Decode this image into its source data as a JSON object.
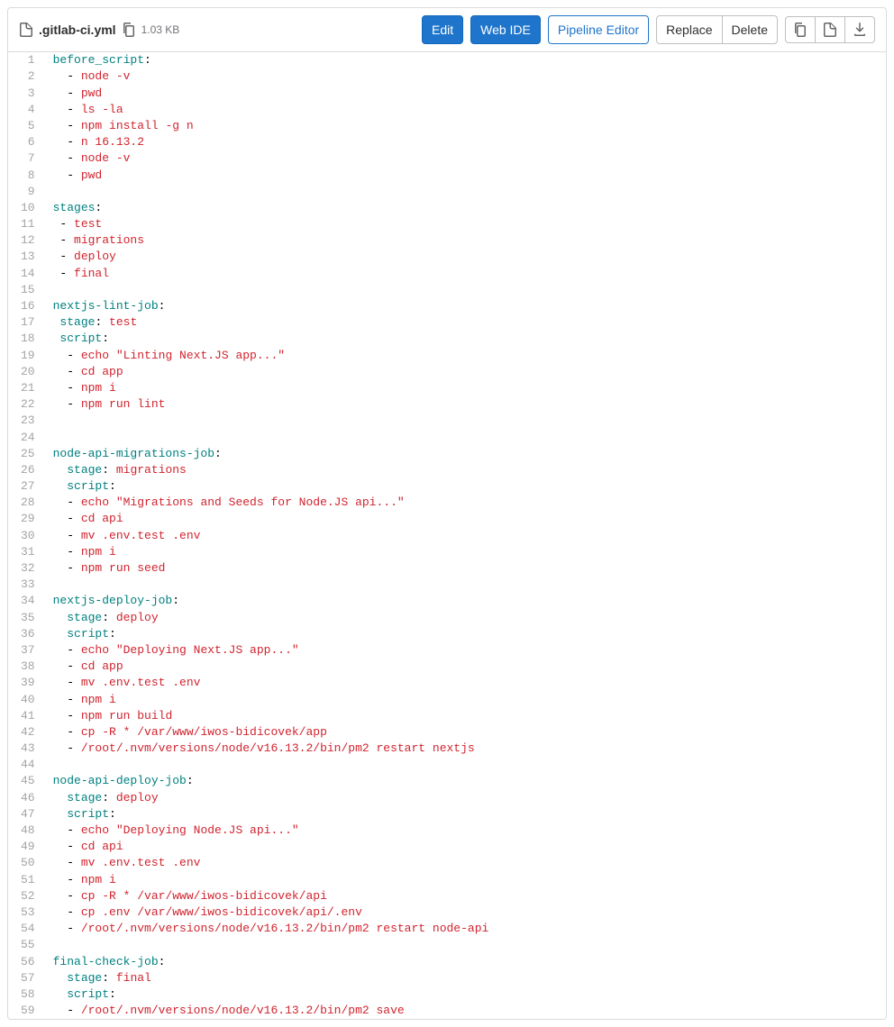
{
  "header": {
    "filename": ".gitlab-ci.yml",
    "filesize": "1.03 KB",
    "buttons": {
      "edit": "Edit",
      "web_ide": "Web IDE",
      "pipeline_editor": "Pipeline Editor",
      "replace": "Replace",
      "delete": "Delete"
    }
  },
  "code": {
    "lines": [
      {
        "n": 1,
        "t": "key",
        "indent": "",
        "key": "before_script",
        "colon": true
      },
      {
        "n": 2,
        "t": "item",
        "indent": "  ",
        "text": "node -v"
      },
      {
        "n": 3,
        "t": "item",
        "indent": "  ",
        "text": "pwd"
      },
      {
        "n": 4,
        "t": "item",
        "indent": "  ",
        "text": "ls -la"
      },
      {
        "n": 5,
        "t": "item",
        "indent": "  ",
        "text": "npm install -g n"
      },
      {
        "n": 6,
        "t": "item",
        "indent": "  ",
        "text": "n 16.13.2"
      },
      {
        "n": 7,
        "t": "item",
        "indent": "  ",
        "text": "node -v"
      },
      {
        "n": 8,
        "t": "item",
        "indent": "  ",
        "text": "pwd"
      },
      {
        "n": 9,
        "t": "blank"
      },
      {
        "n": 10,
        "t": "key",
        "indent": "",
        "key": "stages",
        "colon": true
      },
      {
        "n": 11,
        "t": "item",
        "indent": " ",
        "text": "test"
      },
      {
        "n": 12,
        "t": "item",
        "indent": " ",
        "text": "migrations"
      },
      {
        "n": 13,
        "t": "item",
        "indent": " ",
        "text": "deploy"
      },
      {
        "n": 14,
        "t": "item",
        "indent": " ",
        "text": "final"
      },
      {
        "n": 15,
        "t": "blank"
      },
      {
        "n": 16,
        "t": "key",
        "indent": "",
        "key": "nextjs-lint-job",
        "colon": true
      },
      {
        "n": 17,
        "t": "kv",
        "indent": " ",
        "key": "stage",
        "val": "test"
      },
      {
        "n": 18,
        "t": "key",
        "indent": " ",
        "key": "script",
        "colon": true
      },
      {
        "n": 19,
        "t": "item",
        "indent": "  ",
        "text": "echo \"Linting Next.JS app...\""
      },
      {
        "n": 20,
        "t": "item",
        "indent": "  ",
        "text": "cd app"
      },
      {
        "n": 21,
        "t": "item",
        "indent": "  ",
        "text": "npm i"
      },
      {
        "n": 22,
        "t": "item",
        "indent": "  ",
        "text": "npm run lint"
      },
      {
        "n": 23,
        "t": "blank"
      },
      {
        "n": 24,
        "t": "blank"
      },
      {
        "n": 25,
        "t": "key",
        "indent": "",
        "key": "node-api-migrations-job",
        "colon": true
      },
      {
        "n": 26,
        "t": "kv",
        "indent": "  ",
        "key": "stage",
        "val": "migrations"
      },
      {
        "n": 27,
        "t": "key",
        "indent": "  ",
        "key": "script",
        "colon": true
      },
      {
        "n": 28,
        "t": "item",
        "indent": "  ",
        "text": "echo \"Migrations and Seeds for Node.JS api...\""
      },
      {
        "n": 29,
        "t": "item",
        "indent": "  ",
        "text": "cd api"
      },
      {
        "n": 30,
        "t": "item",
        "indent": "  ",
        "text": "mv .env.test .env"
      },
      {
        "n": 31,
        "t": "item",
        "indent": "  ",
        "text": "npm i"
      },
      {
        "n": 32,
        "t": "item",
        "indent": "  ",
        "text": "npm run seed"
      },
      {
        "n": 33,
        "t": "blank"
      },
      {
        "n": 34,
        "t": "key",
        "indent": "",
        "key": "nextjs-deploy-job",
        "colon": true
      },
      {
        "n": 35,
        "t": "kv",
        "indent": "  ",
        "key": "stage",
        "val": "deploy"
      },
      {
        "n": 36,
        "t": "key",
        "indent": "  ",
        "key": "script",
        "colon": true
      },
      {
        "n": 37,
        "t": "item",
        "indent": "  ",
        "text": "echo \"Deploying Next.JS app...\""
      },
      {
        "n": 38,
        "t": "item",
        "indent": "  ",
        "text": "cd app"
      },
      {
        "n": 39,
        "t": "item",
        "indent": "  ",
        "text": "mv .env.test .env"
      },
      {
        "n": 40,
        "t": "item",
        "indent": "  ",
        "text": "npm i"
      },
      {
        "n": 41,
        "t": "item",
        "indent": "  ",
        "text": "npm run build"
      },
      {
        "n": 42,
        "t": "item",
        "indent": "  ",
        "text": "cp -R * /var/www/iwos-bidicovek/app"
      },
      {
        "n": 43,
        "t": "item",
        "indent": "  ",
        "text": "/root/.nvm/versions/node/v16.13.2/bin/pm2 restart nextjs"
      },
      {
        "n": 44,
        "t": "blank"
      },
      {
        "n": 45,
        "t": "key",
        "indent": "",
        "key": "node-api-deploy-job",
        "colon": true
      },
      {
        "n": 46,
        "t": "kv",
        "indent": "  ",
        "key": "stage",
        "val": "deploy"
      },
      {
        "n": 47,
        "t": "key",
        "indent": "  ",
        "key": "script",
        "colon": true
      },
      {
        "n": 48,
        "t": "item",
        "indent": "  ",
        "text": "echo \"Deploying Node.JS api...\""
      },
      {
        "n": 49,
        "t": "item",
        "indent": "  ",
        "text": "cd api"
      },
      {
        "n": 50,
        "t": "item",
        "indent": "  ",
        "text": "mv .env.test .env"
      },
      {
        "n": 51,
        "t": "item",
        "indent": "  ",
        "text": "npm i"
      },
      {
        "n": 52,
        "t": "item",
        "indent": "  ",
        "text": "cp -R * /var/www/iwos-bidicovek/api"
      },
      {
        "n": 53,
        "t": "item",
        "indent": "  ",
        "text": "cp .env /var/www/iwos-bidicovek/api/.env"
      },
      {
        "n": 54,
        "t": "item",
        "indent": "  ",
        "text": "/root/.nvm/versions/node/v16.13.2/bin/pm2 restart node-api"
      },
      {
        "n": 55,
        "t": "blank"
      },
      {
        "n": 56,
        "t": "key",
        "indent": "",
        "key": "final-check-job",
        "colon": true
      },
      {
        "n": 57,
        "t": "kv",
        "indent": "  ",
        "key": "stage",
        "val": "final"
      },
      {
        "n": 58,
        "t": "key",
        "indent": "  ",
        "key": "script",
        "colon": true
      },
      {
        "n": 59,
        "t": "item",
        "indent": "  ",
        "text": "/root/.nvm/versions/node/v16.13.2/bin/pm2 save"
      }
    ]
  }
}
